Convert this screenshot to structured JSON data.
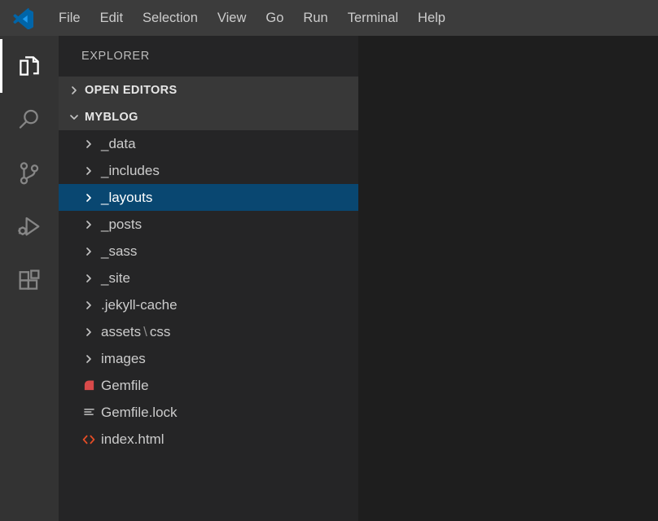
{
  "titlebar": {
    "logo_icon": "vscode-logo-icon",
    "menus": [
      {
        "label": "File"
      },
      {
        "label": "Edit"
      },
      {
        "label": "Selection"
      },
      {
        "label": "View"
      },
      {
        "label": "Go"
      },
      {
        "label": "Run"
      },
      {
        "label": "Terminal"
      },
      {
        "label": "Help"
      }
    ]
  },
  "activitybar": {
    "items": [
      {
        "name": "explorer",
        "icon": "files-icon",
        "active": true
      },
      {
        "name": "search",
        "icon": "search-icon",
        "active": false
      },
      {
        "name": "source-control",
        "icon": "source-control-branch-icon",
        "active": false
      },
      {
        "name": "run-and-debug",
        "icon": "run-debug-play-bug-icon",
        "active": false
      },
      {
        "name": "extensions",
        "icon": "extensions-blocks-icon",
        "active": false
      }
    ]
  },
  "sidebar": {
    "title": "EXPLORER",
    "sections": [
      {
        "label": "OPEN EDITORS",
        "expanded": false,
        "twisty_icon": "chevron-right-icon"
      },
      {
        "label": "MYBLOG",
        "expanded": true,
        "twisty_icon": "chevron-down-icon"
      }
    ],
    "tree": [
      {
        "label": "_data",
        "type": "folder",
        "expanded": false,
        "selected": false,
        "icon": "chevron-right-icon"
      },
      {
        "label": "_includes",
        "type": "folder",
        "expanded": false,
        "selected": false,
        "icon": "chevron-right-icon"
      },
      {
        "label": "_layouts",
        "type": "folder",
        "expanded": false,
        "selected": true,
        "icon": "chevron-right-icon"
      },
      {
        "label": "_posts",
        "type": "folder",
        "expanded": false,
        "selected": false,
        "icon": "chevron-right-icon"
      },
      {
        "label": "_sass",
        "type": "folder",
        "expanded": false,
        "selected": false,
        "icon": "chevron-right-icon"
      },
      {
        "label": "_site",
        "type": "folder",
        "expanded": false,
        "selected": false,
        "icon": "chevron-right-icon"
      },
      {
        "label": ".jekyll-cache",
        "type": "folder",
        "expanded": false,
        "selected": false,
        "icon": "chevron-right-icon"
      },
      {
        "label": "assets",
        "type": "folder",
        "expanded": false,
        "selected": false,
        "icon": "chevron-right-icon",
        "separator": "\\",
        "label2": "css"
      },
      {
        "label": "images",
        "type": "folder",
        "expanded": false,
        "selected": false,
        "icon": "chevron-right-icon"
      },
      {
        "label": "Gemfile",
        "type": "file",
        "selected": false,
        "icon": "ruby-gem-icon",
        "icon_color": "#d94a4a"
      },
      {
        "label": "Gemfile.lock",
        "type": "file",
        "selected": false,
        "icon": "lines-list-icon",
        "icon_color": "#b3b3b3"
      },
      {
        "label": "index.html",
        "type": "file",
        "selected": false,
        "icon": "html-code-icon",
        "icon_color": "#e44d26"
      }
    ]
  },
  "colors": {
    "titlebar_bg": "#3c3c3c",
    "activitybar_bg": "#333333",
    "sidebar_bg": "#252526",
    "section_header_bg": "#383838",
    "editor_bg": "#1e1e1e",
    "selection_bg": "#094771",
    "text": "#cccccc",
    "active_indicator": "#ffffff"
  }
}
